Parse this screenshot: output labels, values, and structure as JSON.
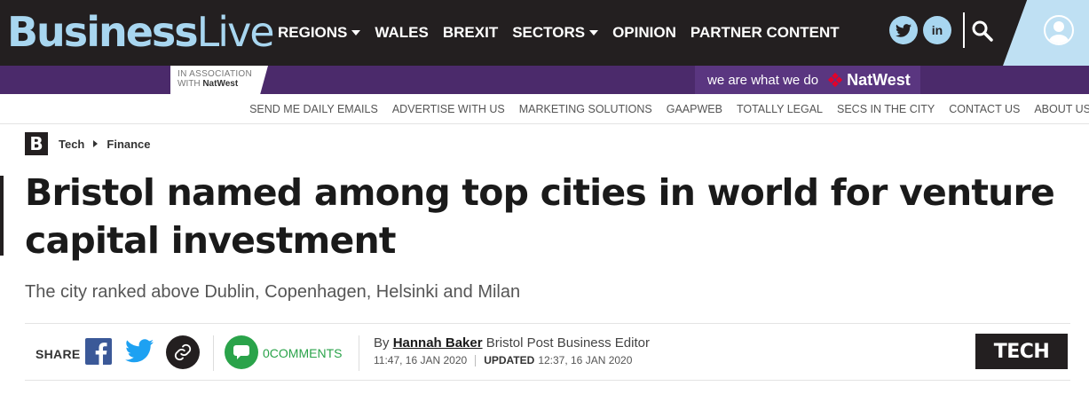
{
  "brand": {
    "logo_bold": "Business",
    "logo_light": "Live"
  },
  "nav": {
    "items": [
      {
        "label": "REGIONS",
        "has_dropdown": true
      },
      {
        "label": "WALES",
        "has_dropdown": false
      },
      {
        "label": "BREXIT",
        "has_dropdown": false
      },
      {
        "label": "SECTORS",
        "has_dropdown": true
      },
      {
        "label": "OPINION",
        "has_dropdown": false
      },
      {
        "label": "PARTNER CONTENT",
        "has_dropdown": false
      }
    ],
    "social_icons": [
      "twitter-icon",
      "linkedin-icon"
    ],
    "linkedin_glyph": "in"
  },
  "sponsor": {
    "assoc_line1": "IN ASSOCIATION",
    "assoc_line2_prefix": "WITH ",
    "assoc_line2_brand": "NatWest",
    "tagline": "we are what we do",
    "brand": "NatWest"
  },
  "utility_links": [
    "SEND ME DAILY EMAILS",
    "ADVERTISE WITH US",
    "MARKETING SOLUTIONS",
    "GAAPWEB",
    "TOTALLY LEGAL",
    "SECS IN THE CITY",
    "CONTACT US",
    "ABOUT US"
  ],
  "breadcrumb": {
    "mark": "B",
    "items": [
      "Tech",
      "Finance"
    ]
  },
  "article": {
    "headline": "Bristol named among top cities in world for venture capital investment",
    "standfirst": "The city ranked above Dublin, Copenhagen, Helsinki and Milan",
    "share_label": "SHARE",
    "comments_count": "0",
    "comments_label": "COMMENTS",
    "byline_prefix": "By",
    "author": "Hannah Baker",
    "author_role": "Bristol Post Business Editor",
    "published": "11:47, 16 JAN 2020",
    "updated_label": "UPDATED",
    "updated": "12:37, 16 JAN 2020",
    "section_tag": "TECH"
  },
  "colors": {
    "topbar": "#231f20",
    "logo": "#a8d6f0",
    "sponsor_strip": "#4b2a6b",
    "comments_green": "#2aa34a",
    "facebook_blue": "#3b5998",
    "twitter_blue": "#1da1f2"
  }
}
